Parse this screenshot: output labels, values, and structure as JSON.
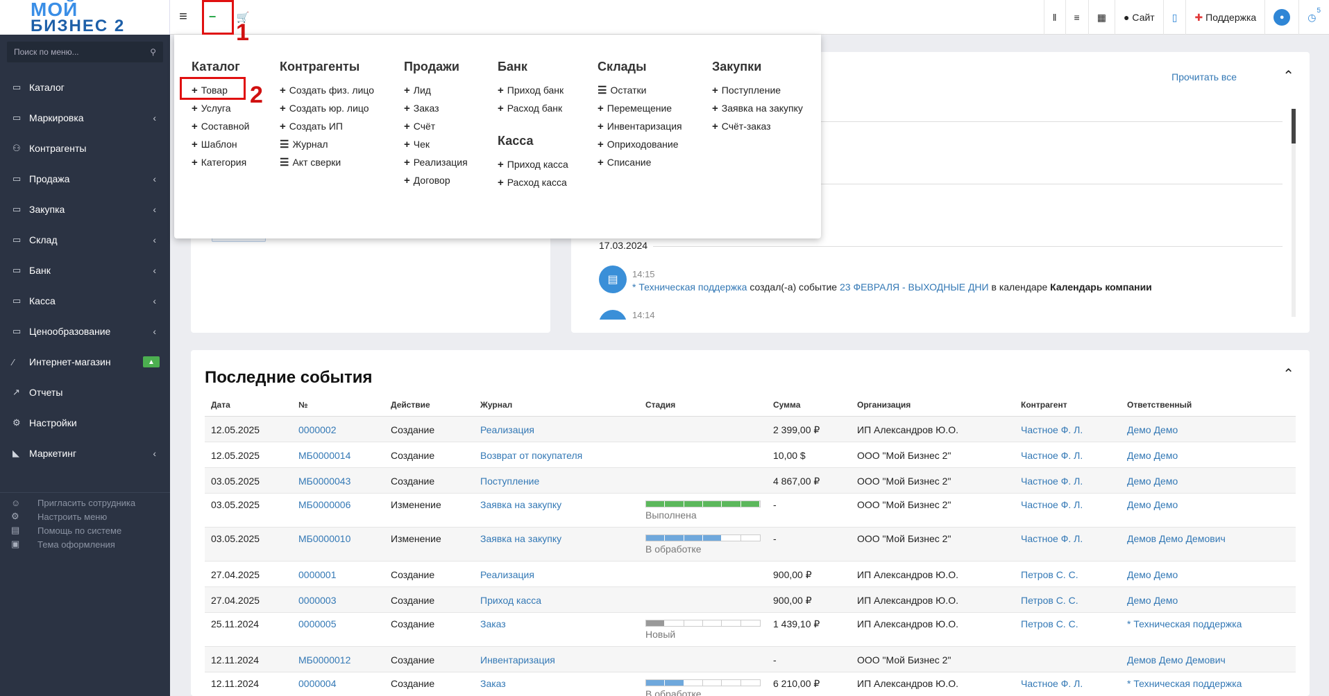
{
  "sidebar": {
    "logo_line1": "МОЙ",
    "logo_line2": "БИЗНЕС 2",
    "search_placeholder": "Поиск по меню...",
    "items": [
      {
        "label": "Каталог",
        "icon": "folder-icon",
        "chevron": false
      },
      {
        "label": "Маркировка",
        "icon": "folder-icon",
        "chevron": true
      },
      {
        "label": "Контрагенты",
        "icon": "users-icon",
        "chevron": false
      },
      {
        "label": "Продажа",
        "icon": "folder-icon",
        "chevron": true
      },
      {
        "label": "Закупка",
        "icon": "folder-icon",
        "chevron": true
      },
      {
        "label": "Склад",
        "icon": "folder-icon",
        "chevron": true
      },
      {
        "label": "Банк",
        "icon": "folder-icon",
        "chevron": true
      },
      {
        "label": "Касса",
        "icon": "folder-icon",
        "chevron": true
      },
      {
        "label": "Ценообразование",
        "icon": "folder-icon",
        "chevron": true
      },
      {
        "label": "Интернет-магазин",
        "icon": "magic-wand-icon",
        "chevron": false,
        "badge": "bell-icon"
      },
      {
        "label": "Отчеты",
        "icon": "line-chart-icon",
        "chevron": false
      },
      {
        "label": "Настройки",
        "icon": "gear-icon",
        "chevron": false
      },
      {
        "label": "Маркетинг",
        "icon": "area-chart-icon",
        "chevron": true
      }
    ],
    "bottom": [
      {
        "label": "Пригласить сотрудника",
        "icon": "user-plus-icon"
      },
      {
        "label": "Настроить меню",
        "icon": "cogs-icon"
      },
      {
        "label": "Помощь по системе",
        "icon": "book-icon"
      },
      {
        "label": "Тема оформления",
        "icon": "image-icon"
      }
    ]
  },
  "topbar": {
    "right": [
      {
        "label": "",
        "icon": "barcode-icon"
      },
      {
        "label": "",
        "icon": "server-icon"
      },
      {
        "label": "",
        "icon": "calendar-icon"
      },
      {
        "label": "Сайт",
        "icon": "globe-icon"
      },
      {
        "label": "",
        "icon": "app-icon"
      },
      {
        "label": "Поддержка",
        "icon": "medkit-icon"
      },
      {
        "label": "",
        "icon": "user-icon"
      },
      {
        "label": "",
        "icon": "clock-icon",
        "badge": "5"
      }
    ]
  },
  "annotations": {
    "one": "1",
    "two": "2"
  },
  "dropdown": {
    "columns": [
      {
        "title": "Каталог",
        "items": [
          {
            "label": "Товар",
            "icon": "plus"
          },
          {
            "label": "Услуга",
            "icon": "plus"
          },
          {
            "label": "Составной",
            "icon": "plus"
          },
          {
            "label": "Шаблон",
            "icon": "plus"
          },
          {
            "label": "Категория",
            "icon": "plus"
          }
        ]
      },
      {
        "title": "Контрагенты",
        "items": [
          {
            "label": "Создать физ. лицо",
            "icon": "plus"
          },
          {
            "label": "Создать юр. лицо",
            "icon": "plus"
          },
          {
            "label": "Создать ИП",
            "icon": "plus"
          },
          {
            "label": "Журнал",
            "icon": "list"
          },
          {
            "label": "Акт сверки",
            "icon": "list"
          }
        ]
      },
      {
        "title": "Продажи",
        "items": [
          {
            "label": "Лид",
            "icon": "plus"
          },
          {
            "label": "Заказ",
            "icon": "plus"
          },
          {
            "label": "Счёт",
            "icon": "plus"
          },
          {
            "label": "Чек",
            "icon": "plus"
          },
          {
            "label": "Реализация",
            "icon": "plus"
          },
          {
            "label": "Договор",
            "icon": "plus"
          }
        ]
      },
      {
        "title": "Банк",
        "items": [
          {
            "label": "Приход банк",
            "icon": "plus"
          },
          {
            "label": "Расход банк",
            "icon": "plus"
          }
        ],
        "title2": "Касса",
        "items2": [
          {
            "label": "Приход касса",
            "icon": "plus"
          },
          {
            "label": "Расход касса",
            "icon": "plus"
          }
        ]
      },
      {
        "title": "Склады",
        "items": [
          {
            "label": "Остатки",
            "icon": "list"
          },
          {
            "label": "Перемещение",
            "icon": "plus"
          },
          {
            "label": "Инвентаризация",
            "icon": "plus"
          },
          {
            "label": "Оприходование",
            "icon": "plus"
          },
          {
            "label": "Списание",
            "icon": "plus"
          }
        ]
      },
      {
        "title": "Закупки",
        "items": [
          {
            "label": "Поступление",
            "icon": "plus"
          },
          {
            "label": "Заявка на закупку",
            "icon": "plus"
          },
          {
            "label": "Счёт-заказ",
            "icon": "plus"
          }
        ]
      }
    ]
  },
  "notifications": {
    "read_all": "Прочитать все",
    "date": "17.03.2024",
    "time": "14:15",
    "author": "* Техническая поддержка",
    "action": "создал(-а) событие",
    "event": "23 ФЕВРАЛЯ - ВЫХОДНЫЕ ДНИ",
    "in_calendar": "в календаре",
    "calendar": "Календарь компании",
    "time2": "14:14"
  },
  "events": {
    "title": "Последние события",
    "headers": [
      "Дата",
      "№",
      "Действие",
      "Журнал",
      "Стадия",
      "Сумма",
      "Организация",
      "Контрагент",
      "Ответственный"
    ],
    "rows": [
      {
        "date": "12.05.2025",
        "num": "0000002",
        "action": "Создание",
        "journal": "Реализация",
        "stage": "",
        "sum": "2 399,00 ₽",
        "org": "ИП Александров Ю.О.",
        "contractor": "Частное Ф. Л.",
        "resp": "Демо Демо"
      },
      {
        "date": "12.05.2025",
        "num": "МБ0000014",
        "action": "Создание",
        "journal": "Возврат от покупателя",
        "stage": "",
        "sum": "10,00 $",
        "org": "ООО \"Мой Бизнес 2\"",
        "contractor": "Частное Ф. Л.",
        "resp": "Демо Демо"
      },
      {
        "date": "03.05.2025",
        "num": "МБ0000043",
        "action": "Создание",
        "journal": "Поступление",
        "stage": "",
        "sum": "4 867,00 ₽",
        "org": "ООО \"Мой Бизнес 2\"",
        "contractor": "Частное Ф. Л.",
        "resp": "Демо Демо"
      },
      {
        "date": "03.05.2025",
        "num": "МБ0000006",
        "action": "Изменение",
        "journal": "Заявка на закупку",
        "stage": "Выполнена",
        "progress": 1.0,
        "color": "#5cb85c",
        "sum": "-",
        "org": "ООО \"Мой Бизнес 2\"",
        "contractor": "Частное Ф. Л.",
        "resp": "Демо Демо"
      },
      {
        "date": "03.05.2025",
        "num": "МБ0000010",
        "action": "Изменение",
        "journal": "Заявка на закупку",
        "stage": "В обработке",
        "progress": 0.67,
        "color": "#6fa8dc",
        "sum": "-",
        "org": "ООО \"Мой Бизнес 2\"",
        "contractor": "Частное Ф. Л.",
        "resp": "Демов Демо Демович"
      },
      {
        "date": "27.04.2025",
        "num": "0000001",
        "action": "Создание",
        "journal": "Реализация",
        "stage": "",
        "sum": "900,00 ₽",
        "org": "ИП Александров Ю.О.",
        "contractor": "Петров С. С.",
        "resp": "Демо Демо"
      },
      {
        "date": "27.04.2025",
        "num": "0000003",
        "action": "Создание",
        "journal": "Приход касса",
        "stage": "",
        "sum": "900,00 ₽",
        "org": "ИП Александров Ю.О.",
        "contractor": "Петров С. С.",
        "resp": "Демо Демо"
      },
      {
        "date": "25.11.2024",
        "num": "0000005",
        "action": "Создание",
        "journal": "Заказ",
        "stage": "Новый",
        "progress": 0.2,
        "color": "#999999",
        "sum": "1 439,10 ₽",
        "org": "ИП Александров Ю.О.",
        "contractor": "Петров С. С.",
        "resp": "* Техническая поддержка"
      },
      {
        "date": "12.11.2024",
        "num": "МБ0000012",
        "action": "Создание",
        "journal": "Инвентаризация",
        "stage": "",
        "sum": "-",
        "org": "ООО \"Мой Бизнес 2\"",
        "contractor": "",
        "resp": "Демов Демо Демович"
      },
      {
        "date": "12.11.2024",
        "num": "0000004",
        "action": "Создание",
        "journal": "Заказ",
        "stage": "В обработке",
        "progress": 0.4,
        "color": "#6fa8dc",
        "sum": "6 210,00 ₽",
        "org": "ИП Александров Ю.О.",
        "contractor": "Частное Ф. Л.",
        "resp": "* Техническая поддержка"
      }
    ]
  }
}
